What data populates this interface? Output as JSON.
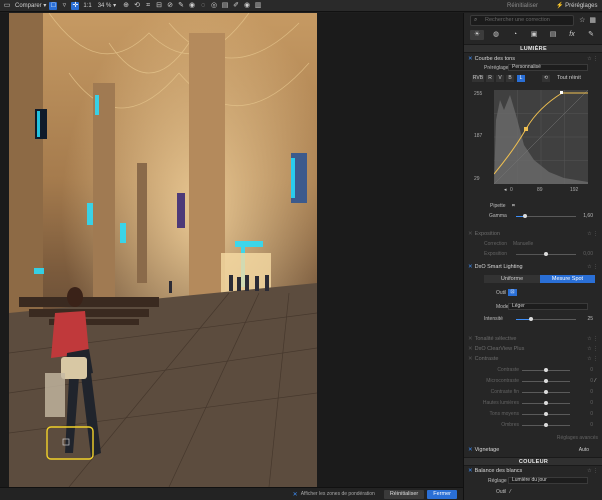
{
  "topbar": {
    "compare_label": "Comparer",
    "zoom_label": "1:1",
    "zoom_value": "34 %"
  },
  "photo": {
    "description_colors": {
      "vault": "#d8b27a",
      "floor": "#6b5a4a",
      "shadow": "#3a2c22",
      "highlight_clip": "#26e0ff"
    }
  },
  "bottombar": {
    "zones_label": "Afficher les zones de pondération",
    "reset_label": "Réinitialiser",
    "close_label": "Fermer"
  },
  "panel": {
    "top_labels": {
      "reset": "Réinitialiser",
      "presets": "Préréglages"
    },
    "search_placeholder": "Rechercher une correction",
    "fx_label": "fx",
    "lumiere": {
      "title": "LUMIÈRE",
      "tone_curve": {
        "title": "Courbe des tons",
        "preset_label": "Préréglage",
        "preset_value": "Personnalisé",
        "channels": [
          "RVB",
          "R",
          "V",
          "B",
          "L"
        ],
        "reset_all": "Tout réinit",
        "y_ticks": [
          "255",
          "187",
          "29"
        ],
        "x_values": [
          "0",
          "89",
          "192"
        ],
        "pipette_label": "Pipette",
        "gamma_label": "Gamma",
        "gamma_value": "1,60",
        "gamma_fraction": 0.15
      },
      "exposure": {
        "title": "Exposition",
        "correction_label": "Correction",
        "correction_value": "Manuelle",
        "exposure_label": "Exposition",
        "exposure_value": "0,00",
        "exposure_fraction": 0.5
      },
      "smart_lighting": {
        "title": "DxO Smart Lighting",
        "mode_uniform": "Uniforme",
        "mode_spot": "Mesure Spot",
        "face_label": "Outil",
        "mode_label": "Mode",
        "mode_value": "Léger",
        "intensity_label": "Intensité",
        "intensity_value": "25",
        "intensity_fraction": 0.25
      },
      "selective_tone": {
        "title": "Tonalité sélective"
      },
      "clearview": {
        "title": "DxO ClearView Plus"
      },
      "contrast": {
        "title": "Contraste",
        "rows": [
          {
            "label": "Contraste",
            "value": "0"
          },
          {
            "label": "Microcontraste",
            "value": "0"
          },
          {
            "label": "Contraste fin",
            "value": "0"
          },
          {
            "label": "Hautes lumières",
            "value": "0"
          },
          {
            "label": "Tons moyens",
            "value": "0"
          },
          {
            "label": "Ombres",
            "value": "0"
          }
        ],
        "advanced": "Réglages avancés"
      },
      "vignetting": {
        "title": "Vignetage",
        "value": "Auto"
      }
    },
    "couleur": {
      "title": "COULEUR",
      "white_balance": {
        "title": "Balance des blancs",
        "preset_label": "Réglage",
        "preset_value": "Lumière du jour",
        "tool_label": "Outil"
      }
    }
  }
}
